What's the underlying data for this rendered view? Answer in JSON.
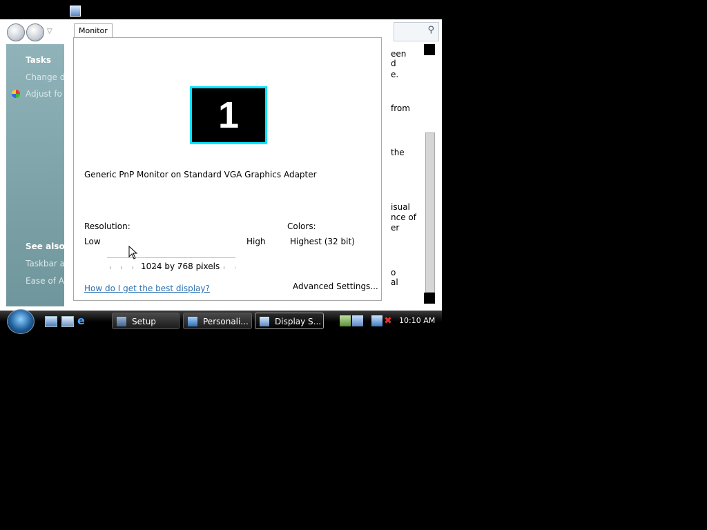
{
  "background_window": {
    "side_panel": {
      "tasks_heading": "Tasks",
      "links": [
        "Change de",
        "Adjust fo"
      ],
      "see_also_heading": "See also",
      "see_also_links": [
        "Taskbar an",
        "Ease of Ac"
      ]
    },
    "right_text_fragments": [
      "een",
      "d",
      "e.",
      "from",
      "the",
      "isual",
      "nce of",
      "er",
      "o",
      "al"
    ]
  },
  "dialog": {
    "tab_label": "Monitor",
    "monitor_number": "1",
    "monitor_description": "Generic PnP Monitor on Standard VGA Graphics Adapter",
    "resolution_label": "Resolution:",
    "low_label": "Low",
    "high_label": "High",
    "resolution_value": "1024 by 768 pixels",
    "colors_label": "Colors:",
    "colors_value": "Highest (32 bit)",
    "help_link": "How do I get the best display?",
    "advanced_button": "Advanced Settings...",
    "colors": {
      "monitor_border": "#00e5ff",
      "link": "#2a6fb2"
    }
  },
  "taskbar": {
    "tasks": [
      {
        "label": "Setup",
        "icon": "setup-icon",
        "active": false
      },
      {
        "label": "Personali...",
        "icon": "personalize-icon",
        "active": false
      },
      {
        "label": "Display S...",
        "icon": "display-settings-icon",
        "active": true
      }
    ],
    "clock": "10:10 AM"
  }
}
